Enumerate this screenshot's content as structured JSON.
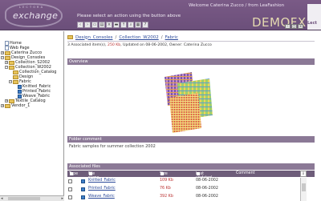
{
  "header": {
    "logo_text": "exchange",
    "logo_small": "L E C T O R A",
    "prompt": "Please select an action using the button above",
    "welcome": "Welcome Caterina Zucco / from LeaFashion",
    "brand": "DEMOFX",
    "lecto_label": "Lect",
    "toolbar_icons": [
      "back-icon",
      "forward-icon",
      "copy-icon",
      "paste-icon",
      "delete-icon",
      "new-folder-icon",
      "upload-icon",
      "search-icon",
      "print-icon",
      "help-icon"
    ],
    "window_buttons": [
      "-",
      "□",
      "×"
    ]
  },
  "tree": {
    "items": [
      {
        "label": "Home",
        "type": "page",
        "depth": 0
      },
      {
        "label": "Web Page",
        "type": "page",
        "depth": 0
      },
      {
        "label": "Caterina Zucco",
        "type": "folder",
        "depth": 0
      },
      {
        "label": "Design_Consoles",
        "type": "folder",
        "depth": 0
      },
      {
        "label": "Collection_S2002",
        "type": "folder",
        "depth": 1
      },
      {
        "label": "Collection_W2002",
        "type": "folder",
        "depth": 1
      },
      {
        "label": "Collection_Catalog",
        "type": "folder",
        "depth": 2
      },
      {
        "label": "Design",
        "type": "folder",
        "depth": 2
      },
      {
        "label": "Fabric",
        "type": "folder",
        "depth": 2
      },
      {
        "label": "Knitted_Fabric",
        "type": "doc",
        "depth": 3
      },
      {
        "label": "Printed_Fabric",
        "type": "doc",
        "depth": 3
      },
      {
        "label": "Weave_Fabric",
        "type": "doc",
        "depth": 3
      },
      {
        "label": "Textile_Catalog",
        "type": "folder",
        "depth": 1
      },
      {
        "label": "Vendor_1",
        "type": "folder",
        "depth": 0
      }
    ]
  },
  "main": {
    "breadcrumb": [
      "Design_Consoles",
      "Collection_W2002",
      "Fabric"
    ],
    "breadcrumb_sep": "/",
    "info_prefix": "3 Associated item(s), ",
    "info_size": "250 Kb",
    "info_suffix": ", Updated on 08-06-2002, Owner: Caterina Zucco",
    "overview_label": "Overview",
    "folder_comment_label": "Folder comment",
    "folder_comment": "Fabric samples for summer collection 2002",
    "associated_label": "Associated files",
    "columns": {
      "type": "Type",
      "name": "File name",
      "size": "Size",
      "updated": "Last updated",
      "comment": "Comment"
    },
    "files": [
      {
        "name": "Knitted_Fabric",
        "size": "109 Kb",
        "date": "08-06-2002"
      },
      {
        "name": "Printed_Fabric",
        "size": "76 Kb",
        "date": "08-06-2002"
      },
      {
        "name": "Weave_Fabric",
        "size": "392 Kb",
        "date": "08-06-2002"
      }
    ]
  },
  "colors": {
    "header": "#6b4f7a",
    "section_bar": "#8b7996",
    "link": "#2c4a9a",
    "size_red": "#b33"
  }
}
